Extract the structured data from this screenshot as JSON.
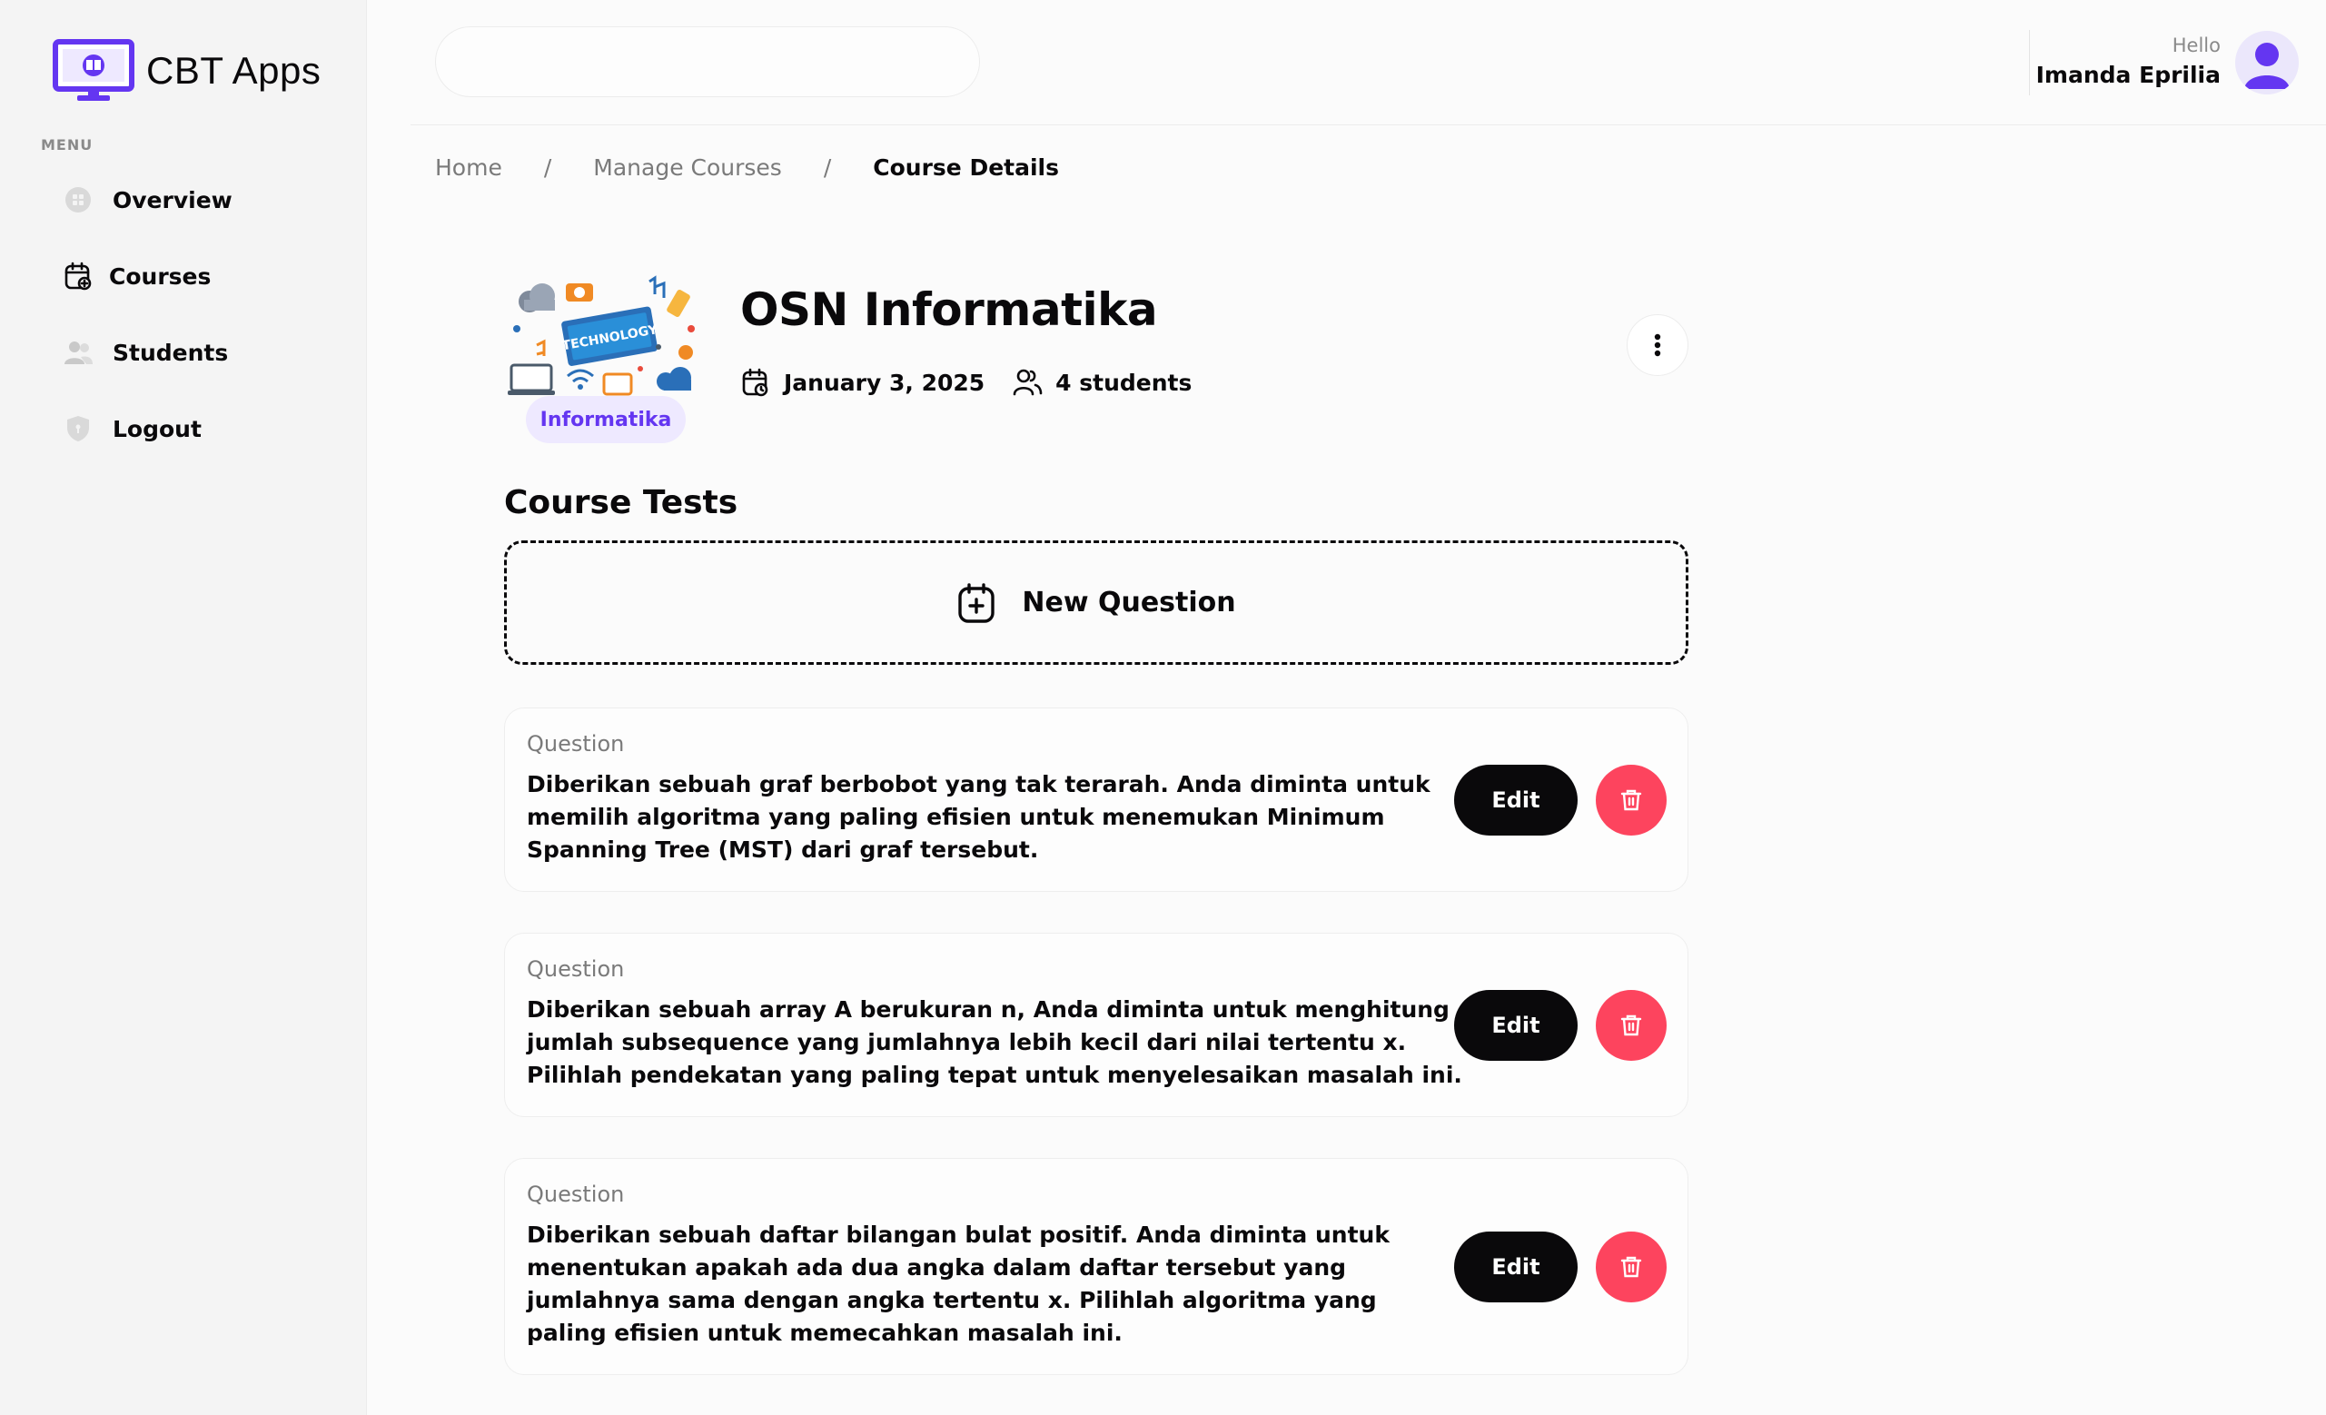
{
  "app": {
    "name": "CBT Apps",
    "menu_heading": "MENU"
  },
  "sidebar": {
    "items": [
      {
        "label": "Overview",
        "icon": "grid-icon"
      },
      {
        "label": "Courses",
        "icon": "calendar-courses-icon"
      },
      {
        "label": "Students",
        "icon": "users-icon"
      },
      {
        "label": "Logout",
        "icon": "shield-icon"
      }
    ]
  },
  "topbar": {
    "search": {
      "placeholder": ""
    },
    "greeting": "Hello",
    "user_name": "Imanda Eprilia"
  },
  "breadcrumb": [
    "Home",
    "Manage Courses",
    "Course Details"
  ],
  "course": {
    "title": "OSN Informatika",
    "category": "Informatika",
    "date": "January 3, 2025",
    "students": "4 students",
    "thumbnail_text": "TECHNOLOGY"
  },
  "tests": {
    "section_title": "Course Tests",
    "new_question_label": "New Question",
    "question_label": "Question",
    "edit_label": "Edit",
    "questions": [
      "Diberikan sebuah graf berbobot yang tak terarah. Anda diminta untuk memilih algoritma yang paling efisien untuk menemukan Minimum Spanning Tree (MST) dari graf tersebut.",
      "Diberikan sebuah array A berukuran n, Anda diminta untuk menghitung jumlah subsequence yang jumlahnya lebih kecil dari nilai tertentu x. Pilihlah pendekatan yang paling tepat untuk menyelesaikan masalah ini.",
      "Diberikan sebuah daftar bilangan bulat positif. Anda diminta untuk menentukan apakah ada dua angka dalam daftar tersebut yang jumlahnya sama dengan angka tertentu x. Pilihlah algoritma yang paling efisien untuk memecahkan masalah ini."
    ]
  },
  "colors": {
    "accent": "#6436f1",
    "danger": "#fd445e",
    "dark": "#0a090b",
    "badge_bg": "#eee9ff"
  }
}
